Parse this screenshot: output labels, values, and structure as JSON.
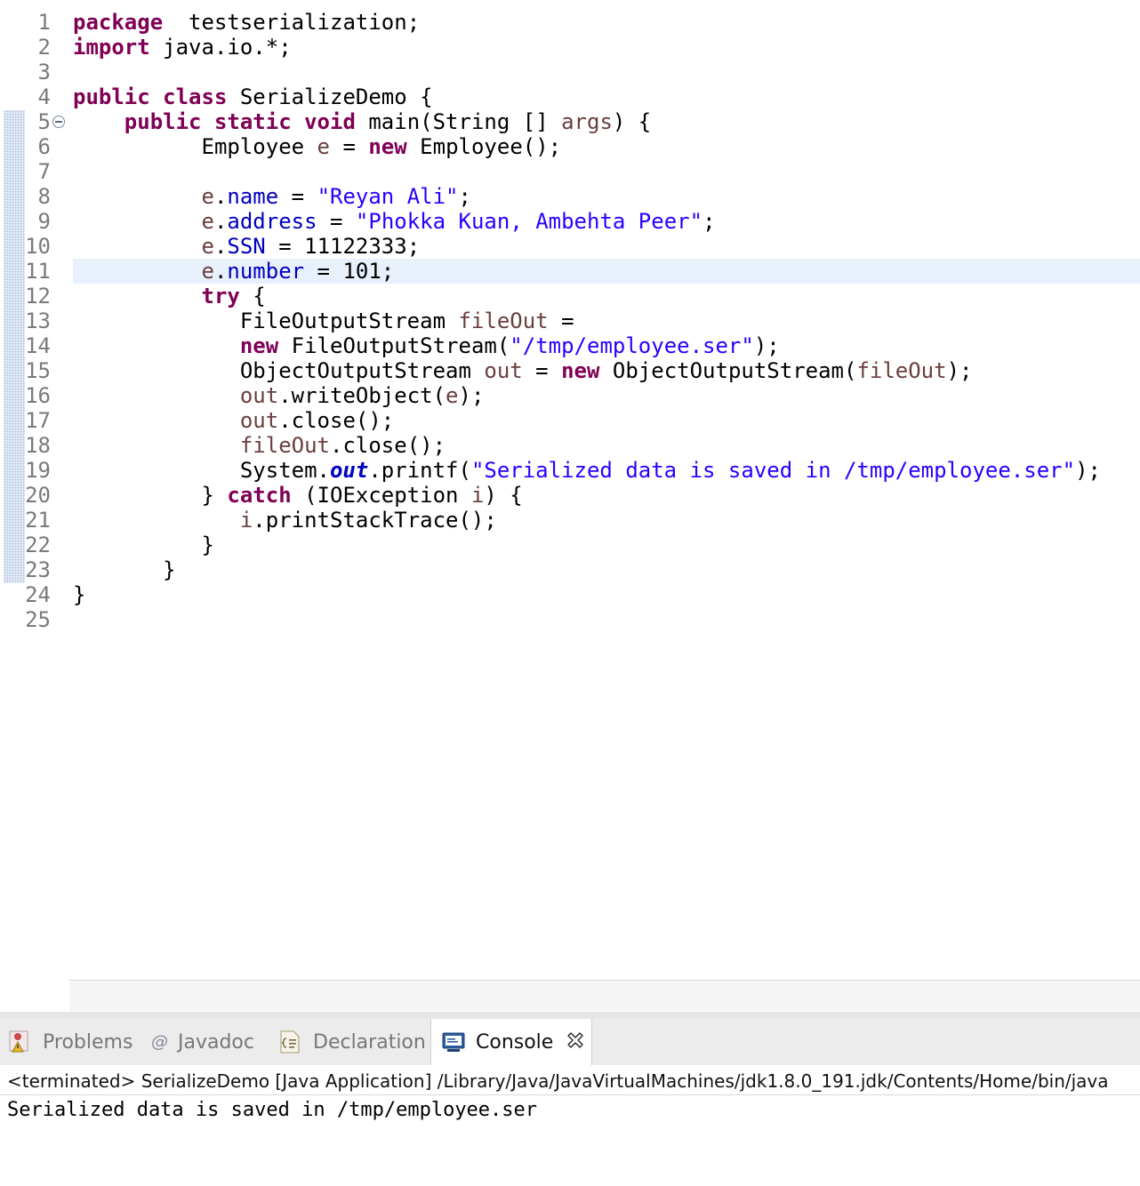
{
  "editor": {
    "line_numbers": [
      "1",
      "2",
      "3",
      "4",
      "5",
      "6",
      "7",
      "8",
      "9",
      "10",
      "11",
      "12",
      "13",
      "14",
      "15",
      "16",
      "17",
      "18",
      "19",
      "20",
      "21",
      "22",
      "23",
      "24",
      "25"
    ],
    "code_lines": [
      [
        [
          "kw",
          "package"
        ],
        [
          "",
          "  testserialization;"
        ]
      ],
      [
        [
          "kw",
          "import"
        ],
        [
          "",
          " java.io.*;"
        ]
      ],
      [],
      [
        [
          "kw",
          "public"
        ],
        [
          "",
          " "
        ],
        [
          "kw",
          "class"
        ],
        [
          "",
          " SerializeDemo {"
        ]
      ],
      [
        [
          "",
          "    "
        ],
        [
          "kw",
          "public"
        ],
        [
          "",
          " "
        ],
        [
          "kw",
          "static"
        ],
        [
          "",
          " "
        ],
        [
          "kw",
          "void"
        ],
        [
          "",
          " main(String [] "
        ],
        [
          "lv",
          "args"
        ],
        [
          "",
          ") {"
        ]
      ],
      [
        [
          "",
          "          Employee "
        ],
        [
          "lv",
          "e"
        ],
        [
          "",
          " = "
        ],
        [
          "kw",
          "new"
        ],
        [
          "",
          " Employee();"
        ]
      ],
      [],
      [
        [
          "",
          "          "
        ],
        [
          "lv",
          "e"
        ],
        [
          "",
          "."
        ],
        [
          "fld",
          "name"
        ],
        [
          "",
          " = "
        ],
        [
          "str",
          "\"Reyan Ali\""
        ],
        [
          "",
          ";"
        ]
      ],
      [
        [
          "",
          "          "
        ],
        [
          "lv",
          "e"
        ],
        [
          "",
          "."
        ],
        [
          "fld",
          "address"
        ],
        [
          "",
          " = "
        ],
        [
          "str",
          "\"Phokka Kuan, Ambehta Peer\""
        ],
        [
          "",
          ";"
        ]
      ],
      [
        [
          "",
          "          "
        ],
        [
          "lv",
          "e"
        ],
        [
          "",
          "."
        ],
        [
          "fld",
          "SSN"
        ],
        [
          "",
          " = 11122333;"
        ]
      ],
      [
        [
          "",
          "          "
        ],
        [
          "lv",
          "e"
        ],
        [
          "",
          "."
        ],
        [
          "fld",
          "number"
        ],
        [
          "",
          " = 101;"
        ]
      ],
      [
        [
          "",
          "          "
        ],
        [
          "kw",
          "try"
        ],
        [
          "",
          " {"
        ]
      ],
      [
        [
          "",
          "             FileOutputStream "
        ],
        [
          "lv",
          "fileOut"
        ],
        [
          "",
          " ="
        ]
      ],
      [
        [
          "",
          "             "
        ],
        [
          "kw",
          "new"
        ],
        [
          "",
          " FileOutputStream("
        ],
        [
          "str",
          "\"/tmp/employee.ser\""
        ],
        [
          "",
          ");"
        ]
      ],
      [
        [
          "",
          "             ObjectOutputStream "
        ],
        [
          "lv",
          "out"
        ],
        [
          "",
          " = "
        ],
        [
          "kw",
          "new"
        ],
        [
          "",
          " ObjectOutputStream("
        ],
        [
          "lv",
          "fileOut"
        ],
        [
          "",
          ");"
        ]
      ],
      [
        [
          "",
          "             "
        ],
        [
          "lv",
          "out"
        ],
        [
          "",
          ".writeObject("
        ],
        [
          "lv",
          "e"
        ],
        [
          "",
          ");"
        ]
      ],
      [
        [
          "",
          "             "
        ],
        [
          "lv",
          "out"
        ],
        [
          "",
          ".close();"
        ]
      ],
      [
        [
          "",
          "             "
        ],
        [
          "lv",
          "fileOut"
        ],
        [
          "",
          ".close();"
        ]
      ],
      [
        [
          "",
          "             System."
        ],
        [
          "sf",
          "out"
        ],
        [
          "",
          ".printf("
        ],
        [
          "str",
          "\"Serialized data is saved in /tmp/employee.ser\""
        ],
        [
          "",
          ");"
        ]
      ],
      [
        [
          "",
          "          } "
        ],
        [
          "kw",
          "catch"
        ],
        [
          "",
          " (IOException "
        ],
        [
          "lv",
          "i"
        ],
        [
          "",
          ") {"
        ]
      ],
      [
        [
          "",
          "             "
        ],
        [
          "lv",
          "i"
        ],
        [
          "",
          ".printStackTrace();"
        ]
      ],
      [
        [
          "",
          "          }"
        ]
      ],
      [
        [
          "",
          "       }"
        ]
      ],
      [
        [
          "",
          "}"
        ]
      ],
      []
    ]
  },
  "tabs": {
    "problems": "Problems",
    "javadoc": "Javadoc",
    "declaration": "Declaration",
    "console": "Console"
  },
  "console": {
    "header": "<terminated> SerializeDemo [Java Application] /Library/Java/JavaVirtualMachines/jdk1.8.0_191.jdk/Contents/Home/bin/java",
    "output": "Serialized data is saved in /tmp/employee.ser"
  },
  "colors": {
    "keyword": "#7f0055",
    "string": "#2a00ff",
    "field": "#0000c0",
    "local_variable": "#6a3e3e",
    "current_line": "#e8f0fb"
  }
}
